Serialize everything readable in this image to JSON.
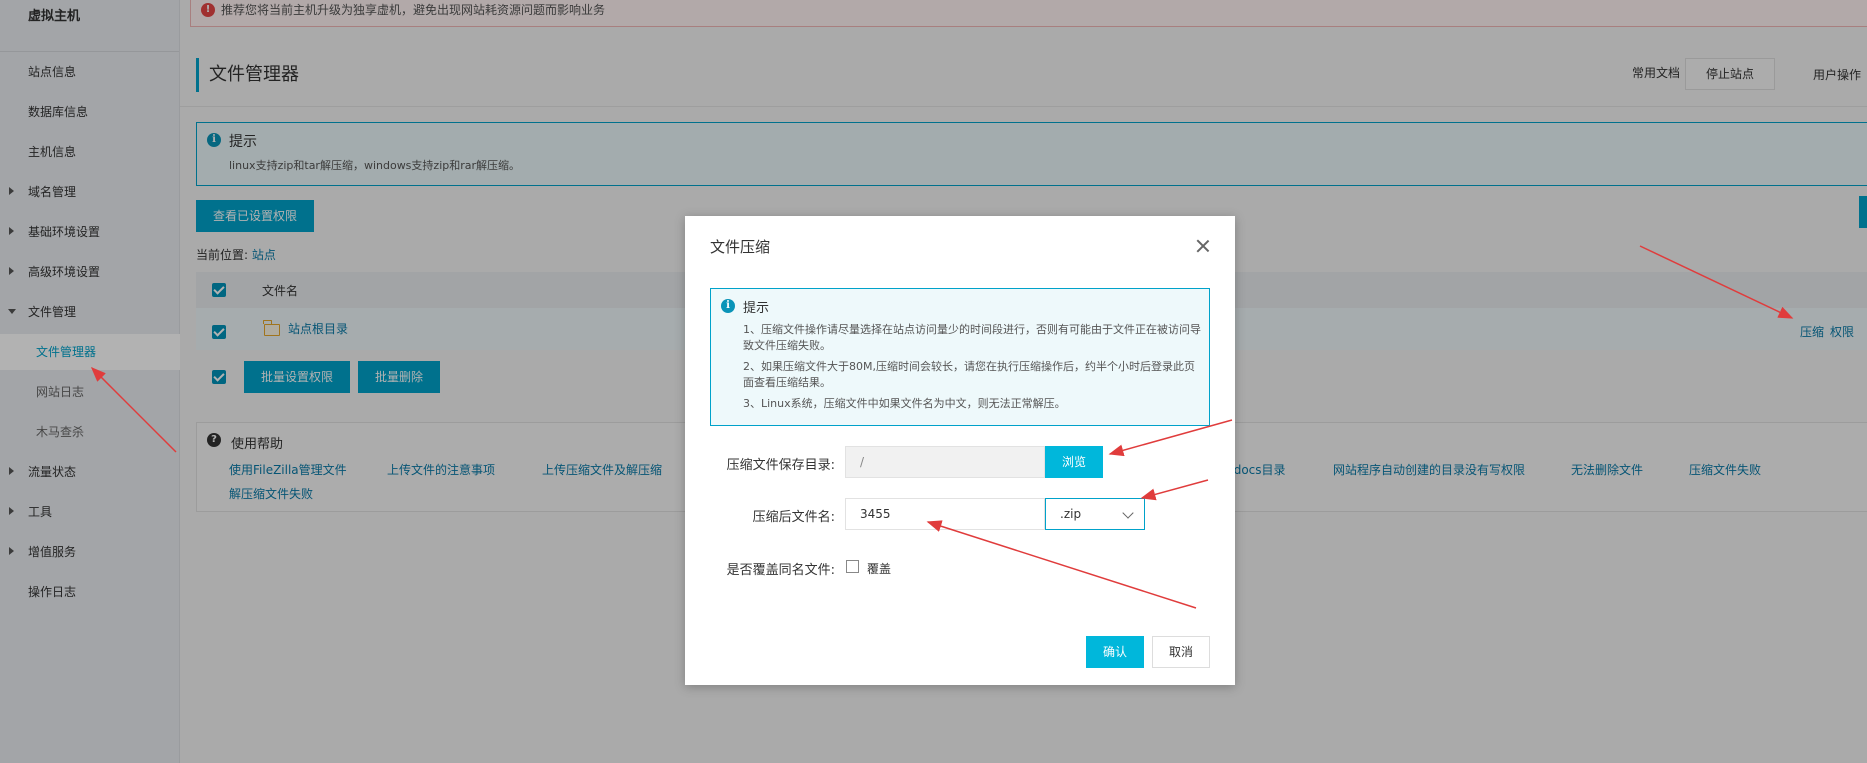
{
  "sidebar": {
    "title": "虚拟主机",
    "items": [
      {
        "label": "站点信息"
      },
      {
        "label": "数据库信息"
      },
      {
        "label": "主机信息"
      },
      {
        "label": "域名管理"
      },
      {
        "label": "基础环境设置"
      },
      {
        "label": "高级环境设置"
      },
      {
        "label": "文件管理"
      },
      {
        "label": "文件管理器"
      },
      {
        "label": "网站日志"
      },
      {
        "label": "木马查杀"
      },
      {
        "label": "流量状态"
      },
      {
        "label": "工具"
      },
      {
        "label": "增值服务"
      },
      {
        "label": "操作日志"
      }
    ]
  },
  "notice": {
    "text": "推荐您将当前主机升级为独享虚机，避免出现网站耗资源问题而影响业务"
  },
  "header": {
    "title": "文件管理器",
    "docs_link": "常用文档",
    "stop_button": "停止站点",
    "user_ops": "用户操作"
  },
  "tip": {
    "title": "提示",
    "text": "linux支持zip和tar解压缩，windows支持zip和rar解压缩。"
  },
  "toolbar": {
    "view_permissions": "查看已设置权限",
    "batch_permissions": "批量设置权限",
    "batch_delete": "批量删除"
  },
  "breadcrumb": {
    "label": "当前位置:",
    "link": "站点"
  },
  "table": {
    "column_name": "文件名",
    "rows": [
      {
        "name": "站点根目录",
        "actions": [
          "压缩",
          "权限"
        ]
      }
    ]
  },
  "help": {
    "title": "使用帮助",
    "links": [
      "使用FileZilla管理文件",
      "上传文件的注意事项",
      "上传压缩文件及解压缩",
      "tdocs目录",
      "网站程序自动创建的目录没有写权限",
      "无法删除文件",
      "压缩文件失败",
      "解压缩文件失败"
    ]
  },
  "modal": {
    "title": "文件压缩",
    "tip_title": "提示",
    "tip_lines": [
      "1、压缩文件操作请尽量选择在站点访问量少的时间段进行，否则有可能由于文件正在被访问导致文件压缩失败。",
      "2、如果压缩文件大于80M,压缩时间会较长，请您在执行压缩操作后，约半个小时后登录此页面查看压缩结果。",
      "3、Linux系统，压缩文件中如果文件名为中文，则无法正常解压。"
    ],
    "save_dir_label": "压缩文件保存目录:",
    "save_dir_value": "/",
    "browse_button": "浏览",
    "filename_label": "压缩后文件名:",
    "filename_value": "3455",
    "extension_value": ".zip",
    "overwrite_label": "是否覆盖同名文件:",
    "overwrite_option": "覆盖",
    "confirm_button": "确认",
    "cancel_button": "取消"
  },
  "colors": {
    "accent": "#00a2ca",
    "annotation_arrow": "#e03c3c"
  }
}
